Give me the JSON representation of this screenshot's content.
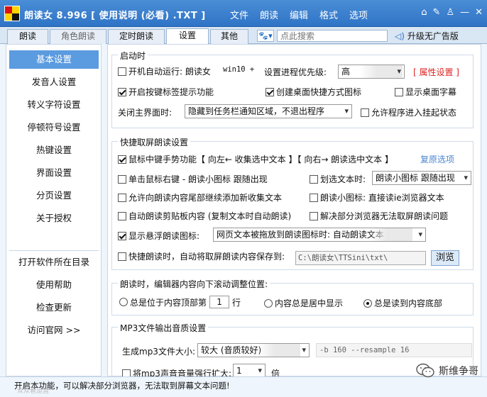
{
  "window": {
    "title": "朗读女 8.996  [ 使用说明 (必看) .TXT ]",
    "menu": [
      "文件",
      "朗读",
      "编辑",
      "格式",
      "选项"
    ],
    "icons": [
      "home-icon",
      "wrench-icon",
      "person-icon",
      "minimize-icon",
      "close-icon"
    ]
  },
  "tabs": [
    "朗读",
    "角色朗读",
    "定时朗读",
    "设置",
    "其他"
  ],
  "active_tab": "设置",
  "search": {
    "placeholder": "点此搜索"
  },
  "upgrade": {
    "icon": "speaker-icon",
    "label": "升级无广告版"
  },
  "sidebar": {
    "items": [
      "基本设置",
      "发音人设置",
      "转义字符设置",
      "停顿符号设置",
      "热键设置",
      "界面设置",
      "分页设置",
      "关于授权"
    ],
    "bottom_items": [
      "打开软件所在目录",
      "使用帮助",
      "检查更新",
      "访问官网 >>"
    ],
    "active": "基本设置"
  },
  "startup": {
    "title": "启动时",
    "autorun": {
      "label": "开机自动运行: 朗读女",
      "checked": false
    },
    "os": "win10 +",
    "priority_label": "设置进程优先级:",
    "priority_value": "高",
    "property_link": "[ 属性设置 ]",
    "hotkey_tag": {
      "label": "开启按键标签提示功能",
      "checked": true
    },
    "desktop_shortcut": {
      "label": "创建桌面快捷方式图标",
      "checked": true
    },
    "desktop_subtitle": {
      "label": "显示桌面字幕",
      "checked": false
    },
    "close_label": "关闭主界面时:",
    "close_value": "隐藏到任务栏通知区域，不退出程序",
    "allow_suspend": {
      "label": "允许程序进入挂起状态",
      "checked": false
    }
  },
  "quick": {
    "title": "快捷取屏朗读设置",
    "middle_gesture": {
      "label": "鼠标中键手势功能【 向左← 收集选中文本 】【 向右→ 朗读选中文本 】",
      "checked": true
    },
    "reset_link": "复原选项",
    "right_click": {
      "label": "单击鼠标右键 - 朗读小图标 跟随出现",
      "checked": false
    },
    "select_text": {
      "label": "划选文本时:",
      "checked": false
    },
    "select_value": "朗读小图标 跟随出现",
    "append_collect": {
      "label": "允许向朗读内容尾部继续添加新收集文本",
      "checked": false
    },
    "small_icon": {
      "label": "朗读小图标: 直接读ie浏览器文本",
      "checked": false
    },
    "clipboard": {
      "label": "自动朗读剪贴板内容 (复制文本时自动朗读)",
      "checked": false
    },
    "browser_fix": {
      "label": "解决部分浏览器无法取屏朗读问题",
      "checked": false
    },
    "floating_icon": {
      "label": "显示悬浮朗读图标:",
      "checked": true
    },
    "floating_value": "网页文本被拖放到朗读图标时: 自动朗读文本",
    "save_to": {
      "label": "快捷朗读时，自动将取屏朗读内容保存到:",
      "checked": false
    },
    "save_path": "C:\\朗读女\\TTSini\\txt\\",
    "browse": "浏览"
  },
  "scroll": {
    "title": "朗读时，编辑器内容向下滚动调整位置:",
    "top_label": "总是位于内容顶部第",
    "top_line": "1",
    "line_unit": "行",
    "center_label": "内容总是居中显示",
    "bottom_label": "总是读到内容底部",
    "selected": "bottom"
  },
  "mp3": {
    "title": "MP3文件输出音质设置",
    "size_label": "生成mp3文件大小:",
    "size_value": "较大 (音质较好)",
    "params": "-b 160 --resample 16",
    "amplify": {
      "label": "将mp3声音音量强行扩大:",
      "checked": false
    },
    "amplify_value": "1",
    "amplify_unit": "倍"
  },
  "status": "开启本功能，可以解决部分浏览器，无法取到屏幕文本问题!",
  "watermark": "斯维争哥",
  "watermark_dim": "众众看运营"
}
